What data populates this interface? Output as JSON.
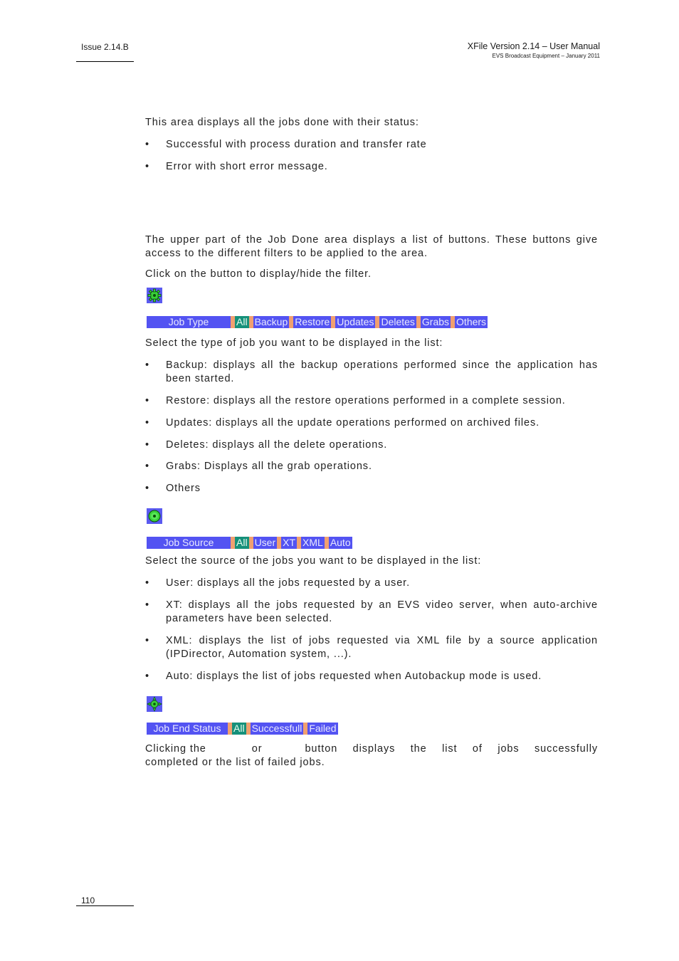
{
  "header": {
    "issue": "Issue 2.14.B",
    "title": "XFile Version 2.14 – User Manual",
    "subtitle": "EVS Broadcast Equipment – January 2011"
  },
  "footer": {
    "page_number": "110"
  },
  "intro": {
    "text": "This area displays all the jobs done with their status:",
    "bullets": [
      "Successful with process duration and transfer rate",
      "Error with short error message."
    ]
  },
  "filters_intro": {
    "text1": "The upper part of the Job Done area displays a list of buttons. These buttons give access to the different filters to be applied to the area.",
    "text2": "Click on the button to display/hide the filter."
  },
  "job_type": {
    "icon": "gear-icon",
    "bar": {
      "title": "Job Type",
      "buttons": [
        "All",
        "Backup",
        "Restore",
        "Updates",
        "Deletes",
        "Grabs",
        "Others"
      ],
      "active": "All"
    },
    "text": "Select the type of job you want to be displayed in the list:",
    "bullets": [
      "Backup: displays all the backup operations performed since the application has been started.",
      "Restore: displays all the restore operations performed in a complete session.",
      "Updates: displays all the update operations performed on archived files.",
      "Deletes: displays all the delete operations.",
      "Grabs: Displays all the grab operations.",
      "Others"
    ]
  },
  "job_source": {
    "icon": "source-circle-icon",
    "bar": {
      "title": "Job Source",
      "buttons": [
        "All",
        "User",
        "XT",
        "XML",
        "Auto"
      ],
      "active": "All"
    },
    "text": "Select the source of the jobs you want to be displayed in the list:",
    "bullets": [
      "User: displays all the jobs requested by a user.",
      "XT: displays all the jobs requested by an EVS video server, when auto-archive parameters have been selected.",
      "XML: displays the list of jobs requested via XML file by a source application (IPDirector, Automation system, ...).",
      "Auto: displays the list of jobs requested when Autobackup mode is used."
    ]
  },
  "job_end_status": {
    "icon": "status-crosshair-icon",
    "bar": {
      "title": "Job End Status",
      "buttons": [
        "All",
        "Successfull",
        "Failed"
      ],
      "active": "All"
    },
    "text_part1": "Clicking the",
    "text_part2": "or",
    "text_part3": "button displays the list of jobs successfully completed or the list of failed jobs."
  },
  "colors": {
    "button_blue": "#5353f2",
    "button_active_teal": "#16907a",
    "separator_orange": "#f0a070"
  }
}
